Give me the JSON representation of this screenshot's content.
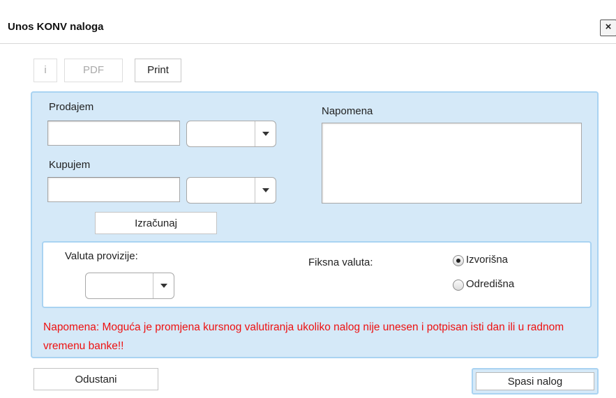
{
  "dialog": {
    "title": "Unos KONV naloga",
    "close_label": "×"
  },
  "toolbar": {
    "info_label": "i",
    "pdf_label": "PDF",
    "print_label": "Print"
  },
  "form": {
    "sell_label": "Prodajem",
    "sell_amount": "",
    "sell_currency": "",
    "buy_label": "Kupujem",
    "buy_amount": "",
    "buy_currency": "",
    "calculate_label": "Izračunaj",
    "note_label": "Napomena",
    "note_value": ""
  },
  "options": {
    "commission_label": "Valuta provizije:",
    "commission_currency": "",
    "fixed_label": "Fiksna valuta:",
    "radio_source_label": "Izvorišna",
    "radio_target_label": "Odredišna",
    "selected": "source"
  },
  "warning": "Napomena: Moguća je promjena kursnog valutiranja ukoliko nalog nije unesen i potpisan isti dan ili u radnom vremenu banke!!",
  "footer": {
    "cancel_label": "Odustani",
    "save_label": "Spasi nalog"
  },
  "colors": {
    "panel_bg": "#d5e9f8",
    "panel_border": "#a9d3f2",
    "warning_text": "#ee1111"
  }
}
